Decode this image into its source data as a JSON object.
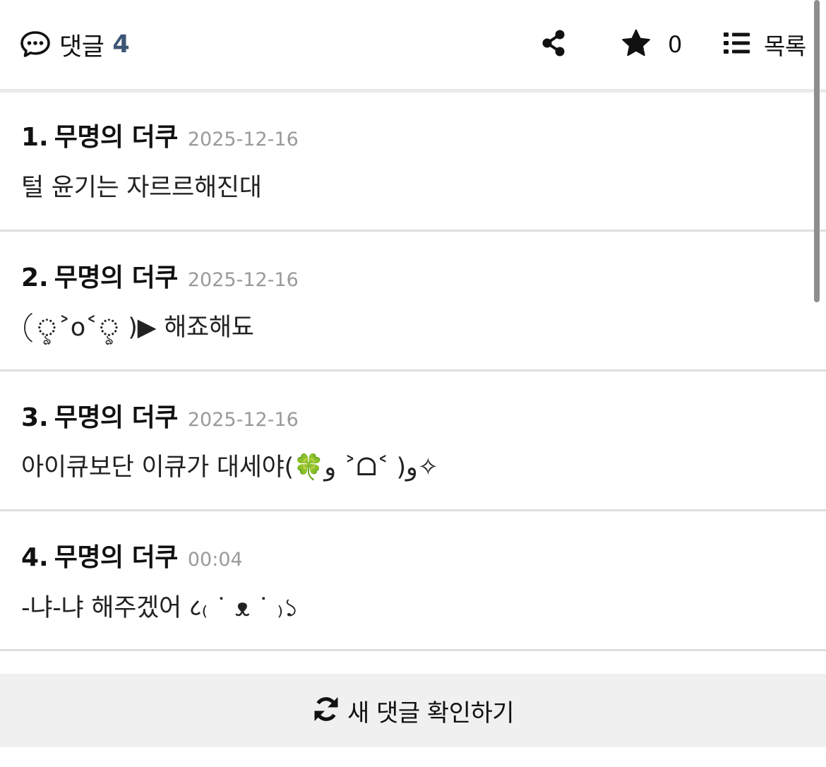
{
  "header": {
    "comments_label": "댓글",
    "comments_count": "4",
    "star_count": "0",
    "list_label": "목록",
    "icons": {
      "comments": "speech-bubble-icon",
      "share": "share-icon",
      "star": "star-icon",
      "list": "list-icon"
    },
    "accent_color": "#3d5575"
  },
  "comments": [
    {
      "number": "1.",
      "author": "무명의 더쿠",
      "date": "2025-12-16",
      "text": "털 윤기는 자르르해진대"
    },
    {
      "number": "2.",
      "author": "무명의 더쿠",
      "date": "2025-12-16",
      "text": "(ৢ˃o˂ৢ )▶ 해죠해됴"
    },
    {
      "number": "3.",
      "author": "무명의 더쿠",
      "date": "2025-12-16",
      "text": "아이큐보단 이큐가 대세야(🍀و ˃ᗝ˂ )و✧"
    },
    {
      "number": "4.",
      "author": "무명의 더쿠",
      "date": "00:04",
      "text": "-냐-냐 해주겠어 ८₍ ˙ ᴥ ˙ ₎১"
    }
  ],
  "refresh_button": {
    "label": "새 댓글 확인하기",
    "icon": "refresh-icon"
  }
}
